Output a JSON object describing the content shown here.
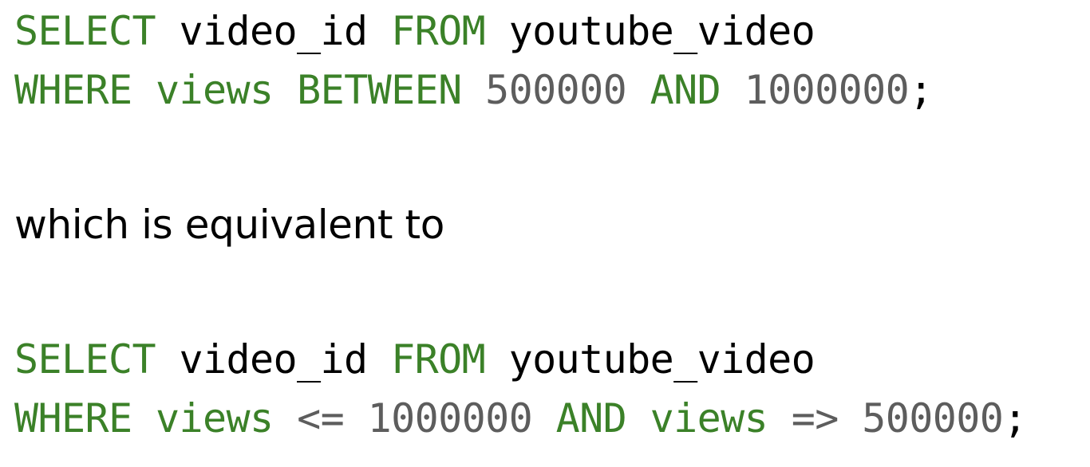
{
  "query1": {
    "line1": {
      "select_kw": "SELECT",
      "column": "video_id",
      "from_kw": "FROM",
      "table": "youtube_video"
    },
    "line2": {
      "where_kw": "WHERE",
      "field": "views",
      "between_kw": "BETWEEN",
      "low": "500000",
      "and_kw": "AND",
      "high": "1000000",
      "terminator": ";"
    }
  },
  "explanation": "which is equivalent to",
  "query2": {
    "line1": {
      "select_kw": "SELECT",
      "column": "video_id",
      "from_kw": "FROM",
      "table": "youtube_video"
    },
    "line2": {
      "where_kw": "WHERE",
      "field1": "views",
      "op1": "<=",
      "value1": "1000000",
      "and_kw": "AND",
      "field2": "views",
      "op2": "=>",
      "value2": "500000",
      "terminator": ";"
    }
  },
  "colors": {
    "keyword": "#3b8128",
    "number": "#5d5d5d",
    "text": "#000000",
    "background": "#ffffff"
  }
}
